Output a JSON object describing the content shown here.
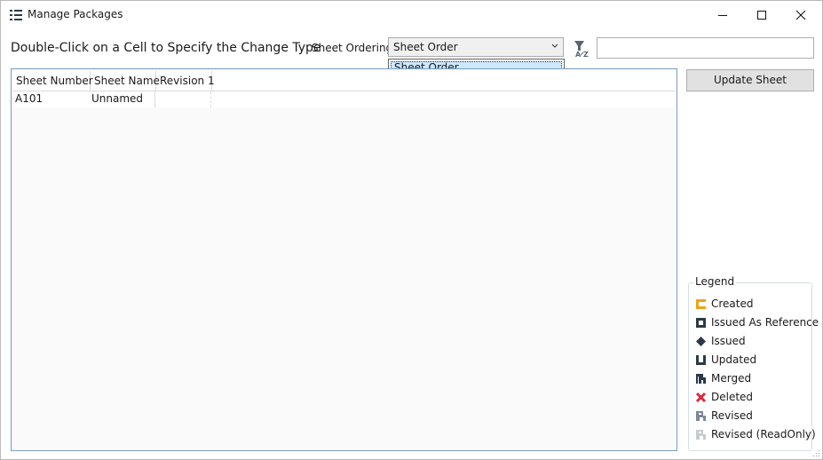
{
  "window": {
    "title": "Manage Packages"
  },
  "toolbar": {
    "instruction": "Double-Click on a Cell to Specify the Change Type",
    "ordering_label": "Sheet Ordering",
    "ordering_value": "Sheet Order",
    "ordering_options": [
      "Sheet Order"
    ],
    "search_value": ""
  },
  "grid": {
    "columns": [
      "Sheet Number",
      "Sheet Name",
      "Revision 1"
    ],
    "rows": [
      {
        "sheet_number": "A101",
        "sheet_name": "Unnamed",
        "revision_1": ""
      }
    ]
  },
  "actions": {
    "update_sheet": "Update Sheet"
  },
  "legend": {
    "title": "Legend",
    "items": [
      {
        "label": "Created",
        "icon": "created-icon",
        "color": "#f0a21a"
      },
      {
        "label": "Issued As Reference",
        "icon": "issued-as-reference-icon",
        "color": "#2b3a4a"
      },
      {
        "label": "Issued",
        "icon": "issued-icon",
        "color": "#2b3a4a"
      },
      {
        "label": "Updated",
        "icon": "updated-icon",
        "color": "#2b3a4a"
      },
      {
        "label": "Merged",
        "icon": "merged-icon",
        "color": "#2b3a4a"
      },
      {
        "label": "Deleted",
        "icon": "deleted-icon",
        "color": "#d8283c"
      },
      {
        "label": "Revised",
        "icon": "revised-icon",
        "color": "#7d8894"
      },
      {
        "label": "Revised (ReadOnly)",
        "icon": "revised-readonly-icon",
        "color": "#c5cbd1"
      }
    ]
  }
}
